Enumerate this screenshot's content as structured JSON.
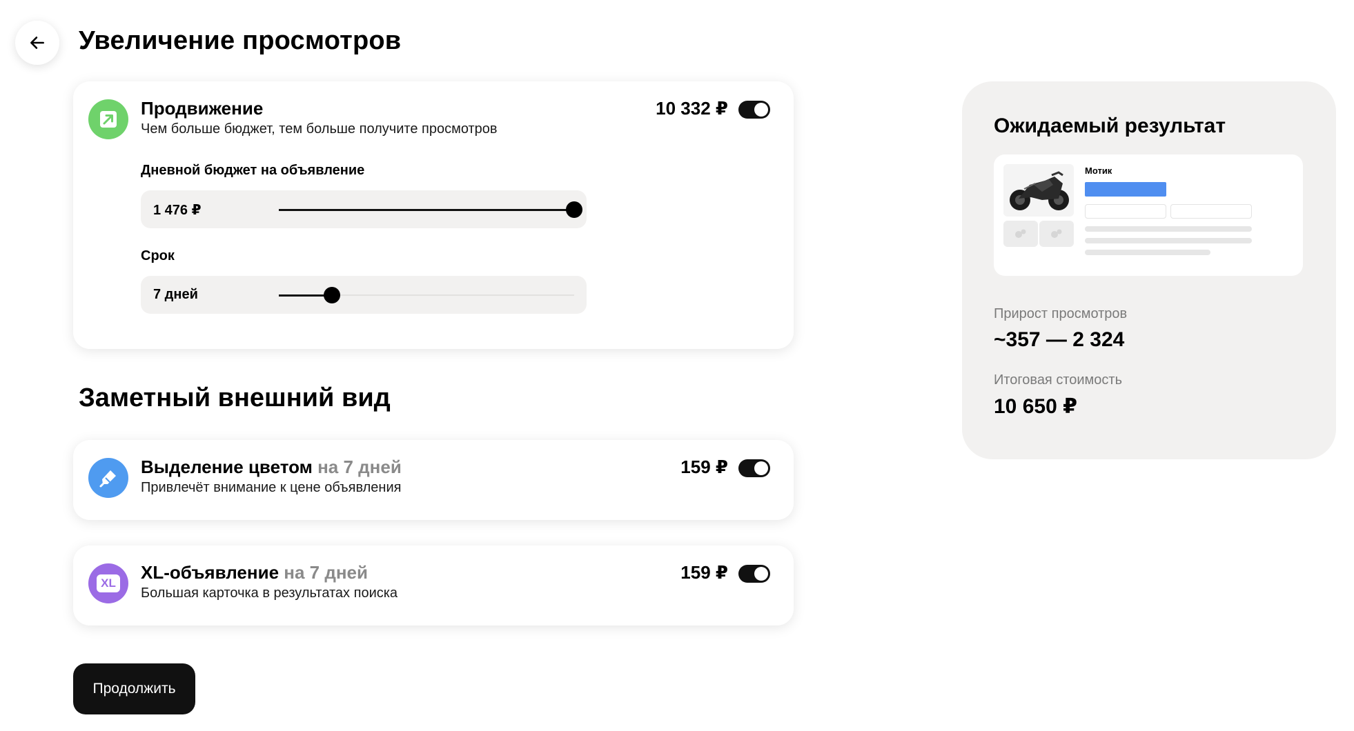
{
  "header": {
    "back_icon": "arrow-left-icon",
    "title": "Увеличение просмотров"
  },
  "promotion": {
    "icon": "arrow-up-right-icon",
    "icon_color": "#6fd26b",
    "title": "Продвижение",
    "description": "Чем больше бюджет, тем больше получите просмотров",
    "price": "10 332 ₽",
    "enabled": true,
    "budget": {
      "label": "Дневной бюджет на объявление",
      "value": "1 476 ₽",
      "position": 1.0
    },
    "duration": {
      "label": "Срок",
      "value": "7 дней",
      "position": 0.18
    }
  },
  "appearance_section": {
    "title": "Заметный внешний вид"
  },
  "color_highlight": {
    "icon": "marker-icon",
    "icon_color": "#4f9bf0",
    "title": "Выделение цветом",
    "period": "на 7 дней",
    "description": "Привлечёт внимание к цене объявления",
    "price": "159 ₽",
    "enabled": true
  },
  "xl_listing": {
    "icon": "xl-icon",
    "icon_color": "#9b6be5",
    "icon_text": "XL",
    "title": "XL-объявление",
    "period": "на 7 дней",
    "description": "Большая карточка в результатах поиска",
    "price": "159 ₽",
    "enabled": true
  },
  "continue_button": {
    "label": "Продолжить"
  },
  "result": {
    "title": "Ожидаемый результат",
    "preview": {
      "name": "Мотик",
      "image": "motorcycle-image",
      "price_bar_color": "#4f8ef0"
    },
    "views_growth_label": "Прирост просмотров",
    "views_growth_value": "~357 — 2 324",
    "total_cost_label": "Итоговая стоимость",
    "total_cost_value": "10 650 ₽"
  }
}
